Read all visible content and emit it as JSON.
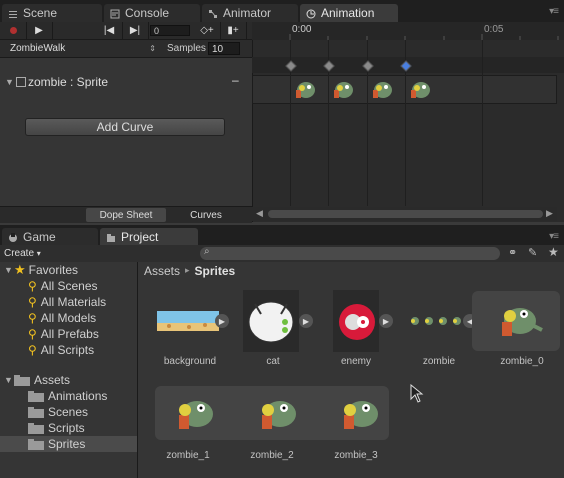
{
  "window": {
    "tabs": [
      {
        "label": "Scene",
        "icon": "scene-icon"
      },
      {
        "label": "Console",
        "icon": "console-icon"
      },
      {
        "label": "Animator",
        "icon": "animator-icon"
      },
      {
        "label": "Animation",
        "icon": "animation-icon",
        "active": true
      }
    ]
  },
  "animation": {
    "frame": "0",
    "clip": "ZombieWalk",
    "samples_label": "Samples",
    "samples_value": "10",
    "property_label": "zombie : Sprite",
    "add_curve_label": "Add Curve",
    "dope_sheet_label": "Dope Sheet",
    "curves_label": "Curves",
    "ruler": {
      "t0": "0:00",
      "t1": "0:05"
    }
  },
  "project_window": {
    "tabs": [
      {
        "label": "Game",
        "icon": "game-icon"
      },
      {
        "label": "Project",
        "icon": "project-icon",
        "active": true
      }
    ],
    "create_label": "Create",
    "favorites": {
      "label": "Favorites",
      "items": [
        "All Scenes",
        "All Materials",
        "All Models",
        "All Prefabs",
        "All Scripts"
      ]
    },
    "assets": {
      "label": "Assets",
      "items": [
        "Animations",
        "Scenes",
        "Scripts",
        "Sprites"
      ],
      "selected": "Sprites"
    },
    "breadcrumb": {
      "root": "Assets",
      "sep": "▸",
      "current": "Sprites"
    },
    "grid_items": [
      "background",
      "cat",
      "enemy",
      "zombie",
      "zombie_0"
    ],
    "expanded_items": [
      "zombie_1",
      "zombie_2",
      "zombie_3"
    ]
  },
  "colors": {
    "accent_blue": "#3f71d8",
    "keyframe": "#8a8a8a",
    "selected_keyframe": "#4a7fe0",
    "favorite_star": "#f0c020",
    "record_red": "#b03030"
  }
}
